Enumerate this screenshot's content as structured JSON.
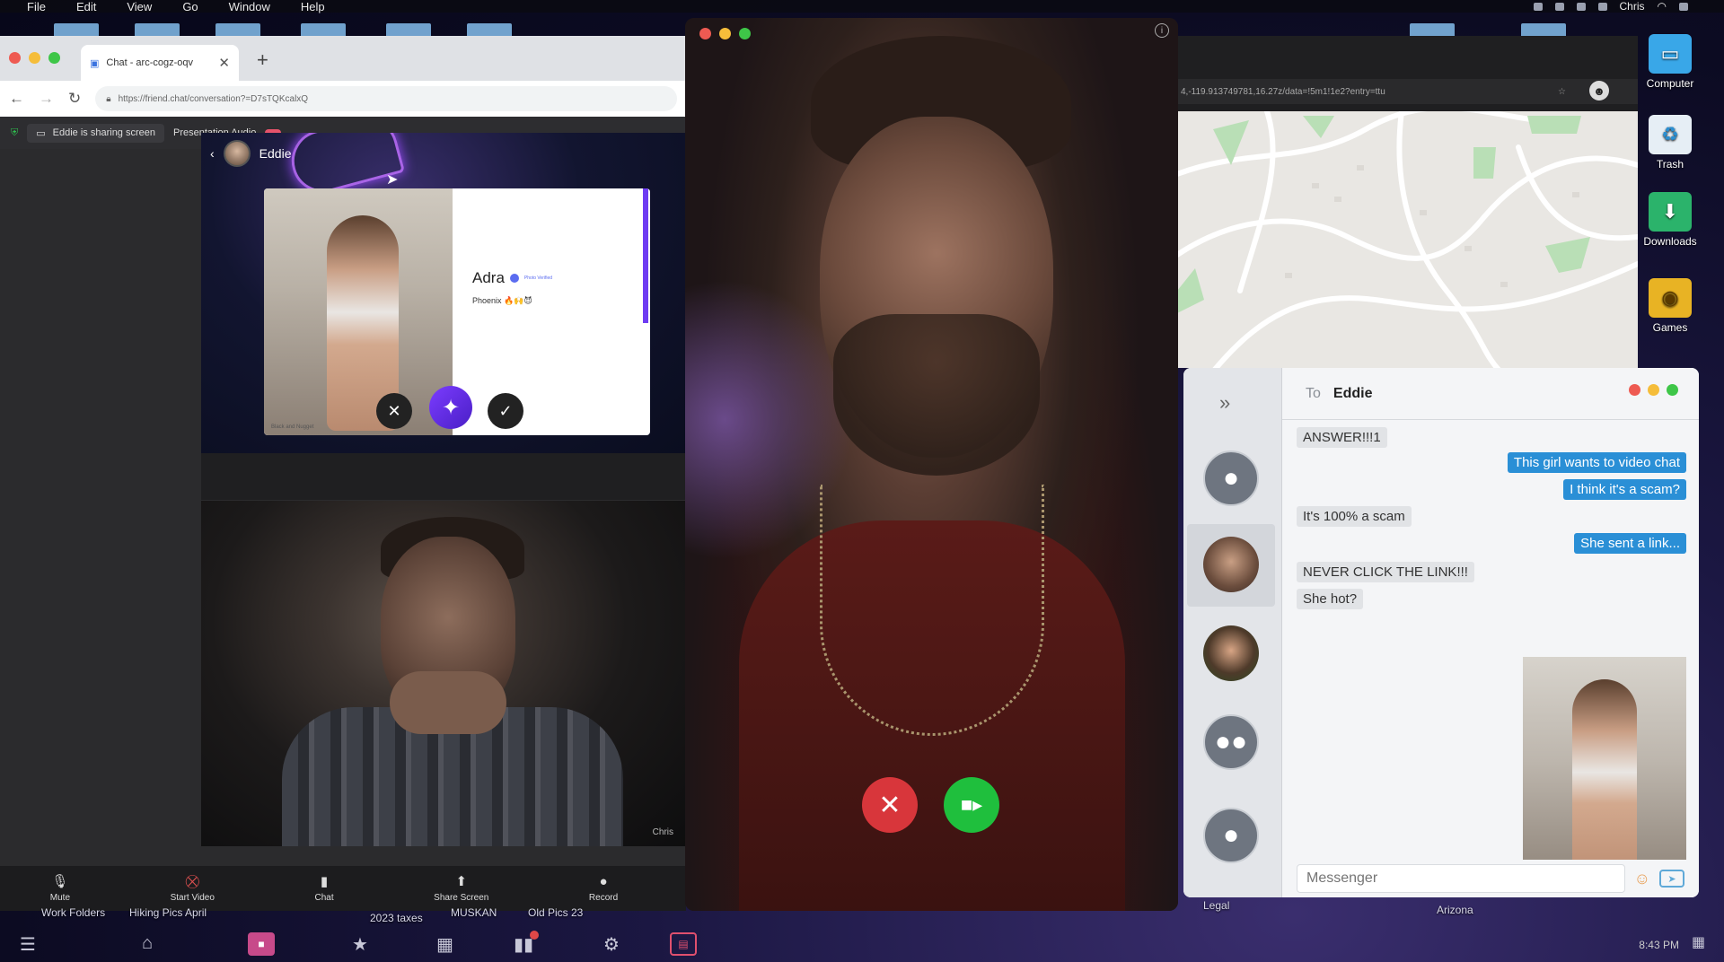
{
  "menubar": {
    "items": [
      "File",
      "Edit",
      "View",
      "Go",
      "Window",
      "Help"
    ],
    "user": "Chris"
  },
  "browser": {
    "tab_title": "Chat - arc-cogz-oqv",
    "url": "https://friend.chat/conversation?=D7sTQKcalxQ",
    "share_status": "Eddie is sharing screen",
    "presentation_audio": "Presentation Audio",
    "shared_screen": {
      "contact_name": "Eddie",
      "profile_name": "Adra",
      "verified_label": "Photo Verified",
      "profile_location": "Phoenix 🔥🙌😈",
      "photo_caption": "Black and Nugget"
    },
    "webcam_name": "Chris"
  },
  "zoom_toolbar": {
    "items": [
      {
        "label": "Mute",
        "icon": "microphone-icon"
      },
      {
        "label": "Start Video",
        "icon": "video-off-icon"
      },
      {
        "label": "Chat",
        "icon": "chat-icon"
      },
      {
        "label": "Share Screen",
        "icon": "share-screen-icon"
      },
      {
        "label": "Record",
        "icon": "record-icon"
      }
    ]
  },
  "map": {
    "url": "4,-119.913749781,16.27z/data=!5m1!1e2?entry=ttu"
  },
  "messenger": {
    "to_label": "To",
    "to_name": "Eddie",
    "messages": [
      {
        "dir": "in",
        "text": "ANSWER!!!1"
      },
      {
        "dir": "out",
        "text": "This girl wants to video chat"
      },
      {
        "dir": "out",
        "text": "I think it's a scam?"
      },
      {
        "dir": "in",
        "text": "It's 100% a scam"
      },
      {
        "dir": "out",
        "text": "She sent a link..."
      },
      {
        "dir": "in",
        "text": "NEVER CLICK THE LINK!!!"
      },
      {
        "dir": "in",
        "text": "She hot?"
      }
    ],
    "input_placeholder": "Messenger"
  },
  "desktop": {
    "icons": [
      {
        "label": "Computer",
        "icon": "computer-icon",
        "color": "#39a7e8"
      },
      {
        "label": "Trash",
        "icon": "trash-icon",
        "color": "#2b8fd1"
      },
      {
        "label": "Downloads",
        "icon": "downloads-icon",
        "color": "#2bb36b"
      },
      {
        "label": "Games",
        "icon": "games-icon",
        "color": "#e8b324"
      }
    ],
    "background_labels": [
      "Work Folders",
      "Hiking Pics April",
      "2023 taxes",
      "MUSKAN",
      "Old Pics 23",
      "Legal",
      "Arizona"
    ]
  },
  "clock": "8:43 PM",
  "colors": {
    "decline": "#d8363b",
    "accept": "#1fbf3d",
    "outgoing_bubble": "#2a8fd6",
    "accent_purple": "#6e3cf2"
  }
}
